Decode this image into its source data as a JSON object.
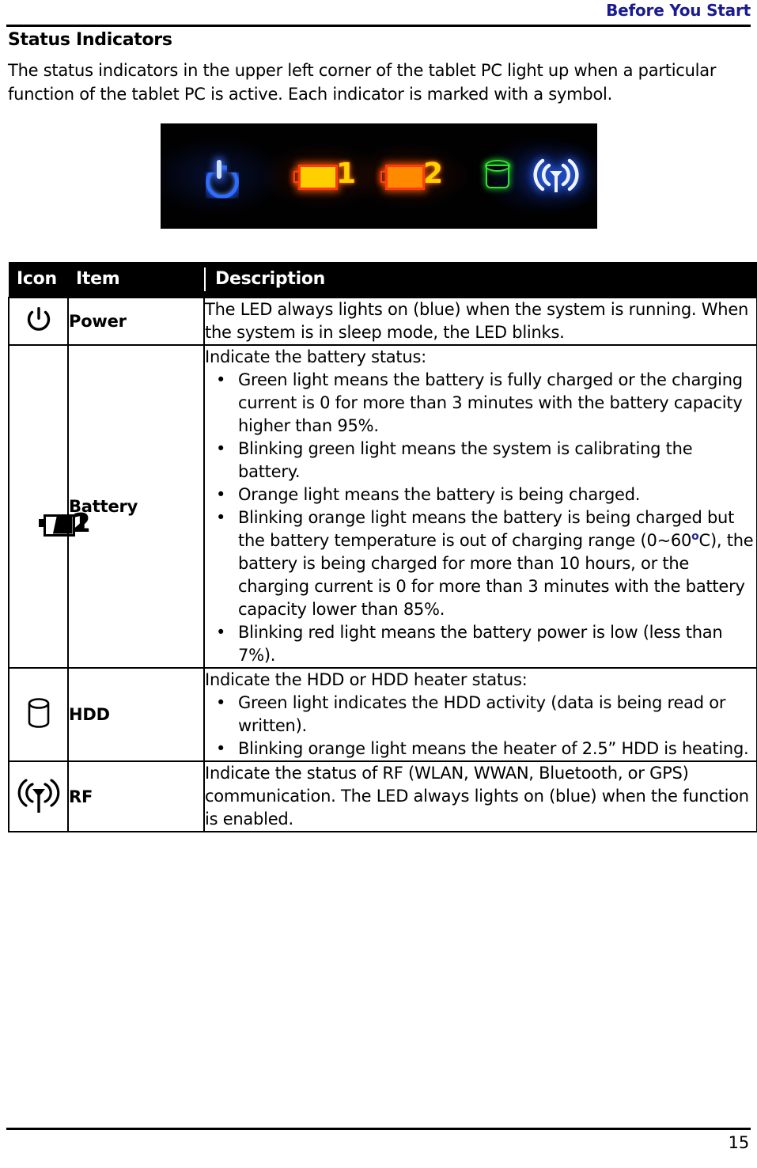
{
  "header": {
    "running_title": "Before You Start",
    "accent_color": "#1b1b8f"
  },
  "section": {
    "title": "Status Indicators",
    "intro": "The status indicators in the upper left corner of the tablet PC light up when a particular function of the tablet PC is active. Each indicator is marked with a symbol."
  },
  "photo": {
    "caption": "",
    "leds": [
      {
        "name": "power-led",
        "label": "power",
        "color": "#2f6dff"
      },
      {
        "name": "battery-1-led",
        "label": "1",
        "color": "#ffd000"
      },
      {
        "name": "battery-2-led",
        "label": "2",
        "color": "#ffd000"
      },
      {
        "name": "hdd-led",
        "label": "hdd",
        "color": "#35e035"
      },
      {
        "name": "rf-led",
        "label": "rf",
        "color": "#e8f0ff"
      }
    ]
  },
  "table": {
    "headers": {
      "icon": "Icon",
      "item": "Item",
      "description": "Description"
    },
    "rows": [
      {
        "icon": "power-icon",
        "item": "Power",
        "lead": "The LED always lights on (blue) when the system is running. When the system is in sleep mode, the LED blinks.",
        "bullets": []
      },
      {
        "icon": "battery-icon",
        "item": "Battery",
        "lead": "Indicate the battery status:",
        "bullets": [
          "Green light means the battery is fully charged or the charging current is 0 for more than 3 minutes with the battery capacity higher than 95%.",
          "Blinking green light means the system is calibrating the battery.",
          "Orange light means the battery is being charged.",
          "BULLET_WITH_DEGREE",
          "Blinking red light means the battery power is low (less than 7%)."
        ],
        "bullet_degree": {
          "before": "Blinking orange light means the battery is being charged but the battery temperature is out of charging range (0~60",
          "sup": "o",
          "after": "C), the battery is being charged for more than 10 hours, or the charging current is 0 for more than 3 minutes with the battery capacity lower than 85%."
        },
        "battery_digits": [
          "1",
          "2"
        ]
      },
      {
        "icon": "hdd-icon",
        "item": "HDD",
        "lead": "Indicate the HDD or HDD heater status:",
        "bullets": [
          "Green light indicates the HDD activity (data is being read or written).",
          "Blinking orange light means the heater of 2.5” HDD is heating."
        ]
      },
      {
        "icon": "rf-icon",
        "item": "RF",
        "lead": "Indicate the status of RF (WLAN, WWAN, Bluetooth, or GPS) communication. The LED always lights on (blue) when the function is enabled.",
        "bullets": []
      }
    ]
  },
  "footer": {
    "page_number": "15"
  }
}
